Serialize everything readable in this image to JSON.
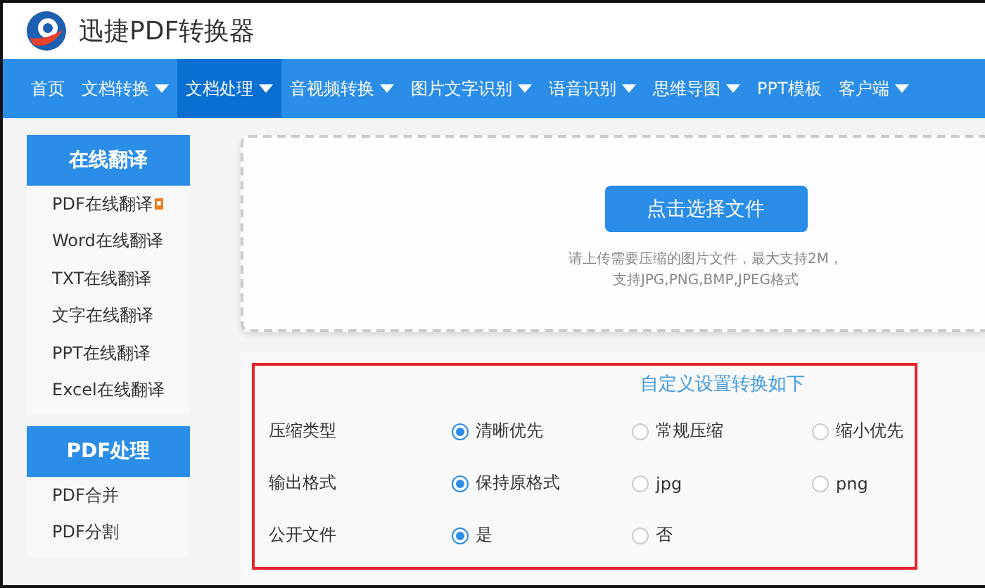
{
  "header": {
    "title": "迅捷PDF转换器"
  },
  "nav": [
    {
      "label": "首页",
      "dropdown": false,
      "selected": false
    },
    {
      "label": "文档转换",
      "dropdown": true,
      "selected": false
    },
    {
      "label": "文档处理",
      "dropdown": true,
      "selected": true
    },
    {
      "label": "音视频转换",
      "dropdown": true,
      "selected": false
    },
    {
      "label": "图片文字识别",
      "dropdown": true,
      "selected": false
    },
    {
      "label": "语音识别",
      "dropdown": true,
      "selected": false
    },
    {
      "label": "思维导图",
      "dropdown": true,
      "selected": false
    },
    {
      "label": "PPT模板",
      "dropdown": false,
      "selected": false
    },
    {
      "label": "客户端",
      "dropdown": true,
      "selected": false
    }
  ],
  "sidebar": [
    {
      "heading": "在线翻译",
      "items": [
        {
          "label": "PDF在线翻译",
          "flagged": true
        },
        {
          "label": "Word在线翻译",
          "flagged": false
        },
        {
          "label": "TXT在线翻译",
          "flagged": false
        },
        {
          "label": "文字在线翻译",
          "flagged": false
        },
        {
          "label": "PPT在线翻译",
          "flagged": false
        },
        {
          "label": "Excel在线翻译",
          "flagged": false
        }
      ]
    },
    {
      "heading": "PDF处理",
      "items": [
        {
          "label": "PDF合并",
          "flagged": false
        },
        {
          "label": "PDF分割",
          "flagged": false
        }
      ]
    }
  ],
  "upload": {
    "button": "点击选择文件",
    "hint_lines": [
      "请上传需要压缩的图片文件，最大支持2M，",
      "支持JPG,PNG,BMP,JPEG格式"
    ]
  },
  "settings": {
    "title": "自定义设置转换如下",
    "rows": [
      {
        "label": "压缩类型",
        "options": [
          {
            "label": "清晰优先",
            "selected": true
          },
          {
            "label": "常规压缩",
            "selected": false
          },
          {
            "label": "缩小优先",
            "selected": false
          }
        ]
      },
      {
        "label": "输出格式",
        "options": [
          {
            "label": "保持原格式",
            "selected": true
          },
          {
            "label": "jpg",
            "selected": false
          },
          {
            "label": "png",
            "selected": false
          }
        ]
      },
      {
        "label": "公开文件",
        "options": [
          {
            "label": "是",
            "selected": true
          },
          {
            "label": "否",
            "selected": false
          }
        ]
      }
    ]
  }
}
